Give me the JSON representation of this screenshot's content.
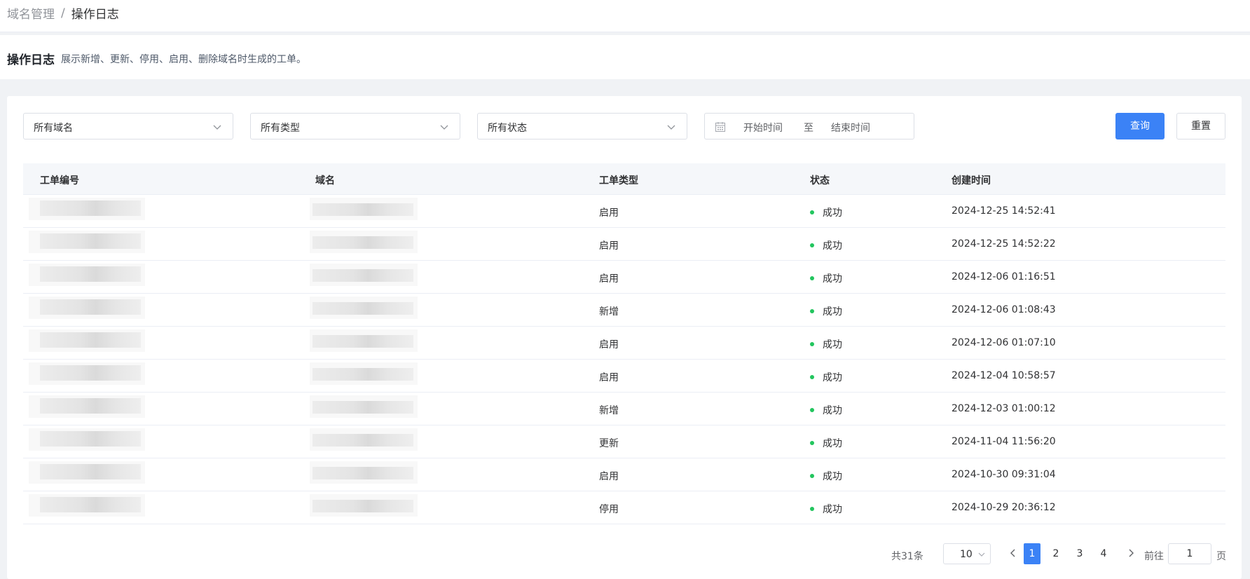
{
  "breadcrumb": {
    "parent": "域名管理",
    "separator": "/",
    "current": "操作日志"
  },
  "header": {
    "title": "操作日志",
    "description": "展示新增、更新、停用、启用、删除域名时生成的工单。"
  },
  "filters": {
    "domain_select": "所有域名",
    "type_select": "所有类型",
    "status_select": "所有状态",
    "date_start_placeholder": "开始时间",
    "date_separator": "至",
    "date_end_placeholder": "结束时间",
    "query_label": "查询",
    "reset_label": "重置"
  },
  "table": {
    "columns": [
      "工单编号",
      "域名",
      "工单类型",
      "状态",
      "创建时间"
    ],
    "rows": [
      {
        "type": "启用",
        "status": "成功",
        "created": "2024-12-25 14:52:41"
      },
      {
        "type": "启用",
        "status": "成功",
        "created": "2024-12-25 14:52:22"
      },
      {
        "type": "启用",
        "status": "成功",
        "created": "2024-12-06 01:16:51"
      },
      {
        "type": "新增",
        "status": "成功",
        "created": "2024-12-06 01:08:43"
      },
      {
        "type": "启用",
        "status": "成功",
        "created": "2024-12-06 01:07:10"
      },
      {
        "type": "启用",
        "status": "成功",
        "created": "2024-12-04 10:58:57"
      },
      {
        "type": "新增",
        "status": "成功",
        "created": "2024-12-03 01:00:12"
      },
      {
        "type": "更新",
        "status": "成功",
        "created": "2024-11-04 11:56:20"
      },
      {
        "type": "启用",
        "status": "成功",
        "created": "2024-10-30 09:31:04"
      },
      {
        "type": "停用",
        "status": "成功",
        "created": "2024-10-29 20:36:12"
      }
    ]
  },
  "pagination": {
    "total": "共31条",
    "page_size": "10",
    "pages": [
      "1",
      "2",
      "3",
      "4"
    ],
    "current_page": "1",
    "goto_label": "前往",
    "goto_value": "1",
    "goto_unit": "页"
  },
  "colors": {
    "primary": "#3b82f6",
    "success": "#22c55e"
  },
  "icons": {
    "calendar": "calendar-icon",
    "chevron": "chevron-down-icon",
    "prev": "chevron-left-icon",
    "next": "chevron-right-icon"
  }
}
